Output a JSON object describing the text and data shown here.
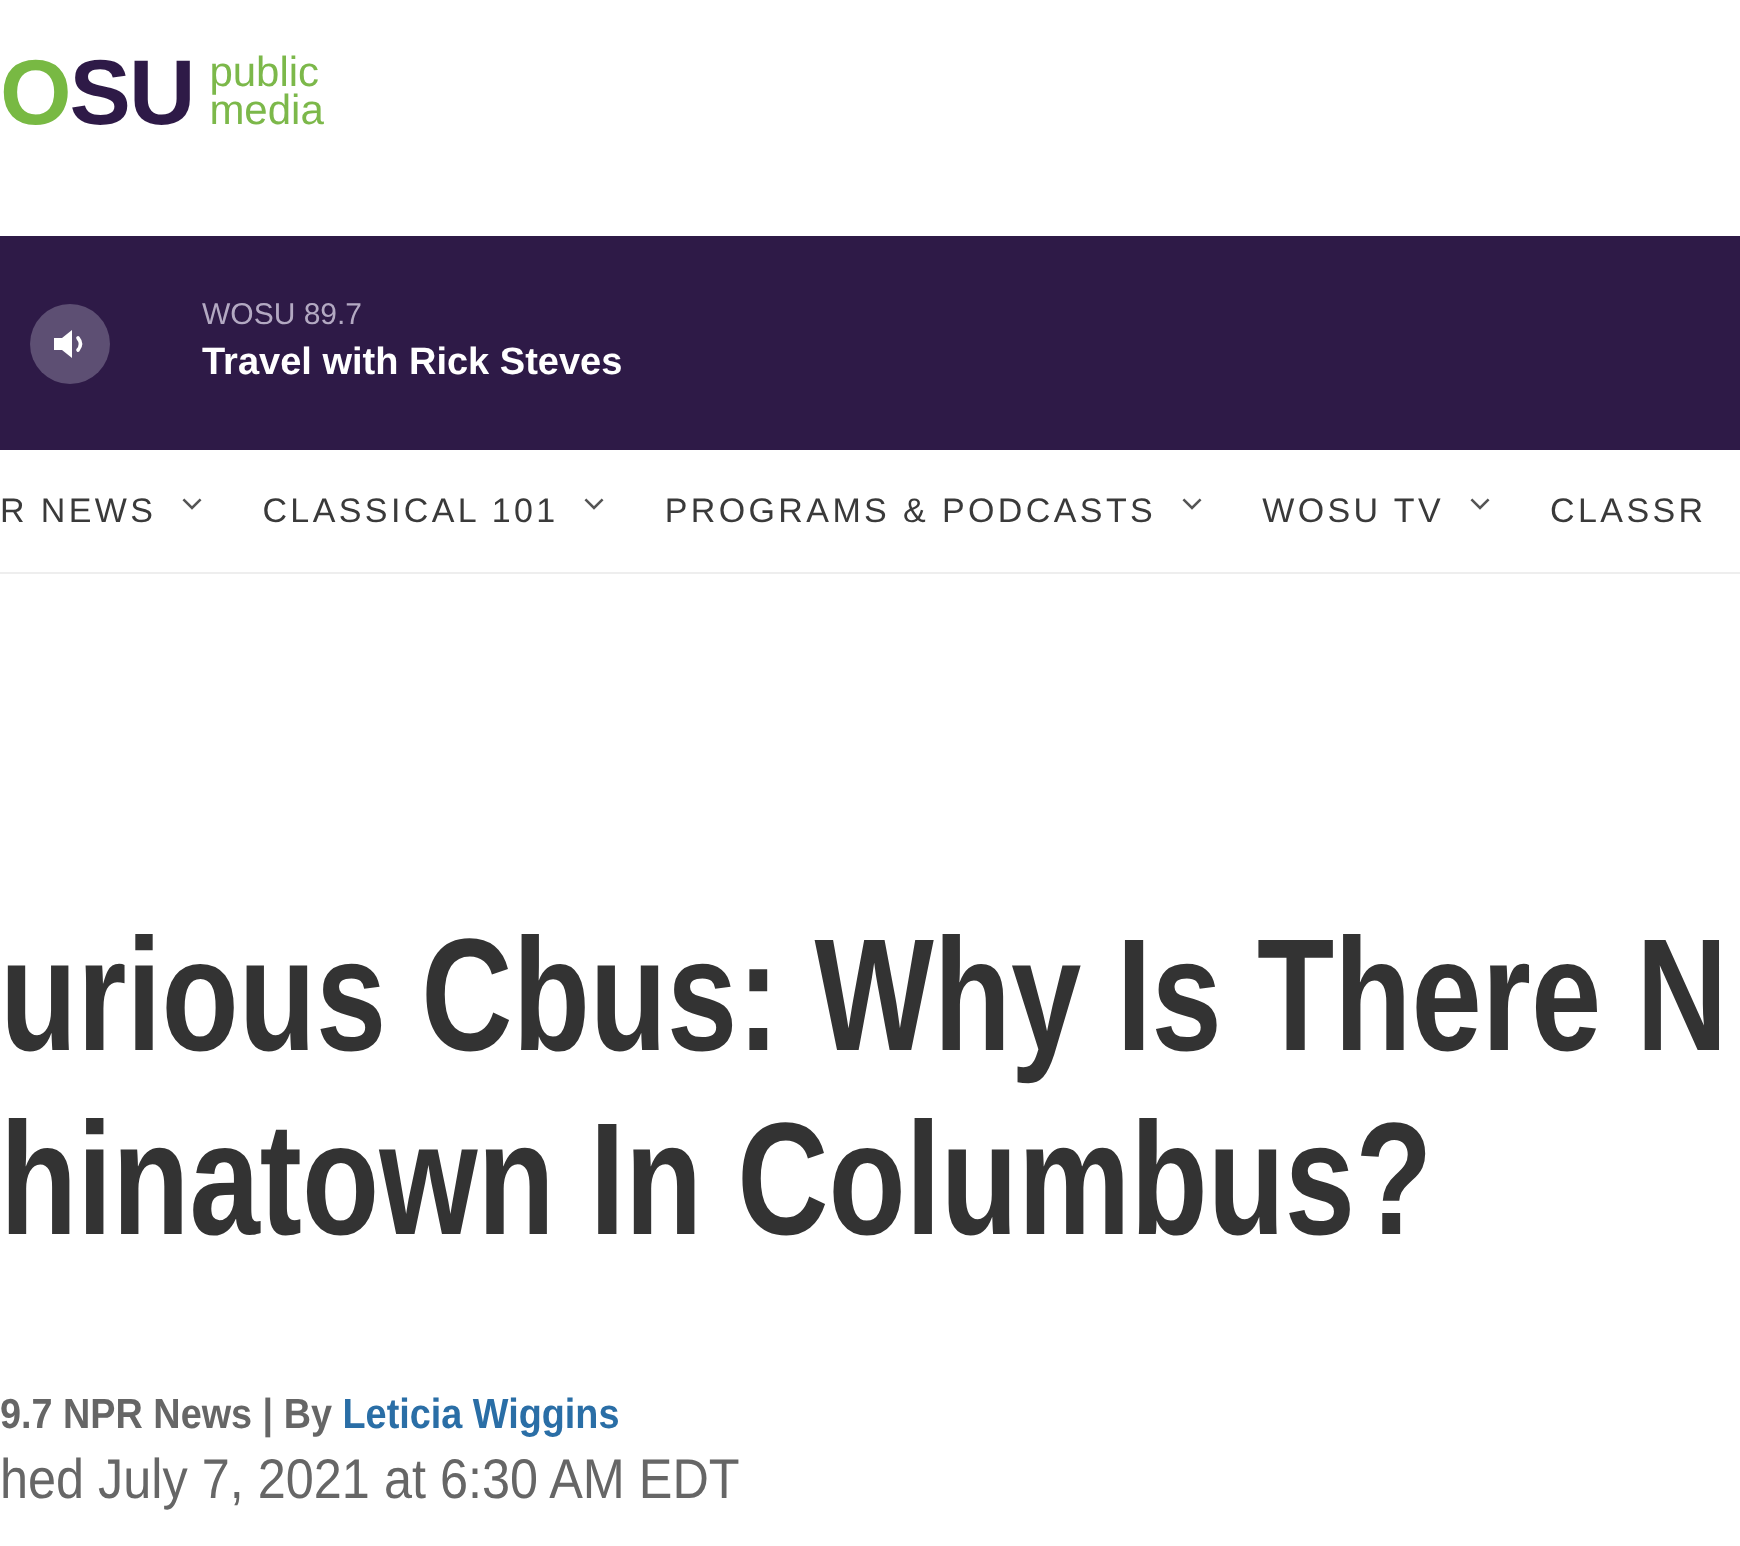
{
  "logo": {
    "wordmark": "OSU",
    "tagline": "public media"
  },
  "player": {
    "station": "WOSU 89.7",
    "program": "Travel with Rick Steves"
  },
  "nav": {
    "items": [
      {
        "label": "R NEWS",
        "dropdown": true
      },
      {
        "label": "CLASSICAL 101",
        "dropdown": true
      },
      {
        "label": "PROGRAMS & PODCASTS",
        "dropdown": true
      },
      {
        "label": "WOSU TV",
        "dropdown": true
      },
      {
        "label": "CLASSR",
        "dropdown": false
      }
    ]
  },
  "article": {
    "headline_lines": [
      "urious Cbus: Why Is There N",
      "hinatown In Columbus?"
    ],
    "byline": {
      "source": "9.7 NPR News | By",
      "author": "Leticia Wiggins"
    },
    "published": "hed July 7, 2021 at 6:30 AM EDT"
  }
}
